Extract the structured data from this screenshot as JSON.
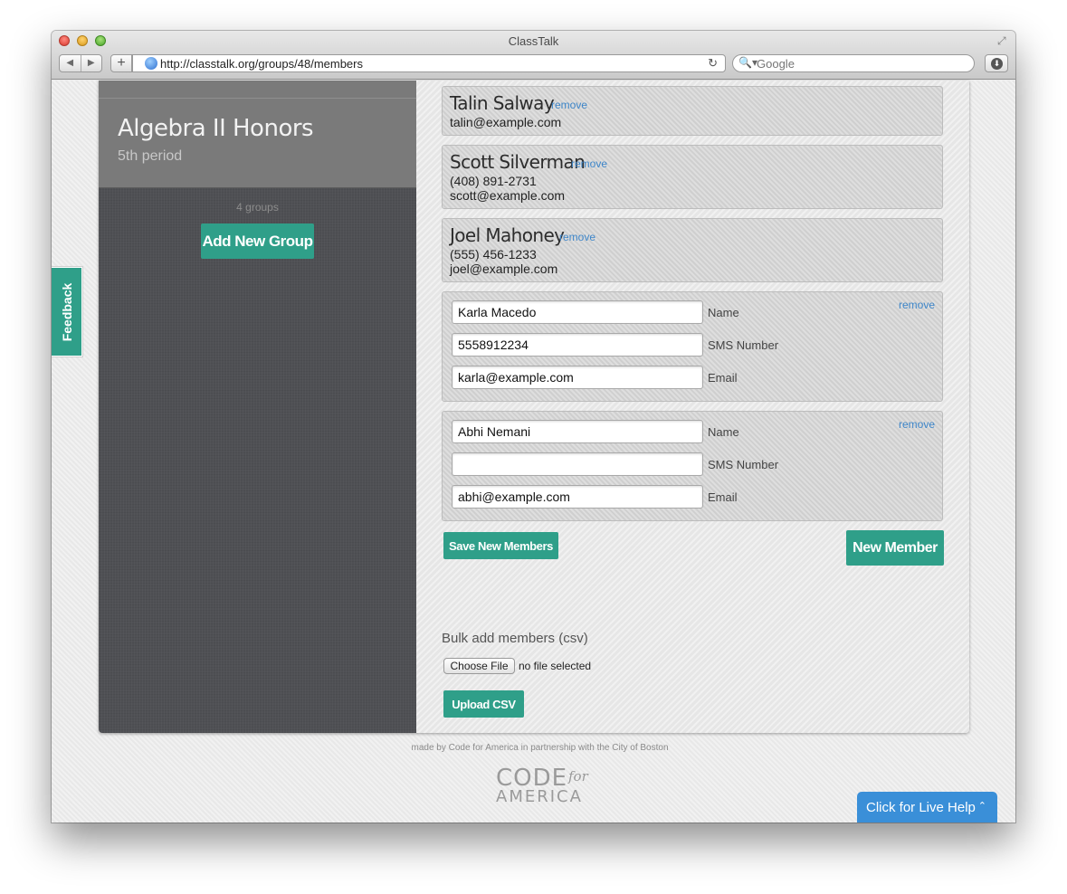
{
  "window": {
    "title": "ClassTalk"
  },
  "toolbar": {
    "url": "http://classtalk.org/groups/48/members",
    "search_placeholder": "Google",
    "back_glyph": "◀",
    "forward_glyph": "▶",
    "add_glyph": "+",
    "reload_glyph": "↻",
    "search_glyph": "🔍▾",
    "download_glyph": "⬇",
    "fullscreen_glyph": "⤢"
  },
  "sidebar": {
    "group_name": "Algebra II Honors",
    "group_subtitle": "5th period",
    "groups_count": "4 groups",
    "add_group_label": "Add New Group"
  },
  "members": [
    {
      "name": "Talin Salway",
      "phone": "",
      "email": "talin@example.com",
      "remove_label": "remove"
    },
    {
      "name": "Scott Silverman",
      "phone": "(408) 891-2731",
      "email": "scott@example.com",
      "remove_label": "remove"
    },
    {
      "name": "Joel Mahoney",
      "phone": "(555) 456-1233",
      "email": "joel@example.com",
      "remove_label": "remove"
    }
  ],
  "new_members": [
    {
      "name_value": "Karla Macedo",
      "sms_value": "5558912234",
      "email_value": "karla@example.com",
      "remove_label": "remove"
    },
    {
      "name_value": "Abhi Nemani",
      "sms_value": "",
      "email_value": "abhi@example.com",
      "remove_label": "remove"
    }
  ],
  "form_labels": {
    "name": "Name",
    "sms": "SMS Number",
    "email": "Email"
  },
  "actions": {
    "save_new_members": "Save New Members",
    "new_member": "New Member",
    "bulk_label": "Bulk add members (csv)",
    "choose_file": "Choose File",
    "no_file": "no file selected",
    "upload_csv": "Upload CSV"
  },
  "feedback_label": "Feedback",
  "footer": {
    "text": "made by Code for America in partnership with the City of Boston",
    "logo_code": "CODE",
    "logo_for": "for",
    "logo_america": "AMERICA"
  },
  "live_help": {
    "label": "Click for Live Help",
    "chevron": "⌃"
  },
  "colors": {
    "accent": "#2f9f89",
    "link": "#3e86c9",
    "live_help": "#3a8fd8",
    "sidebar_bg": "#4f5054"
  }
}
